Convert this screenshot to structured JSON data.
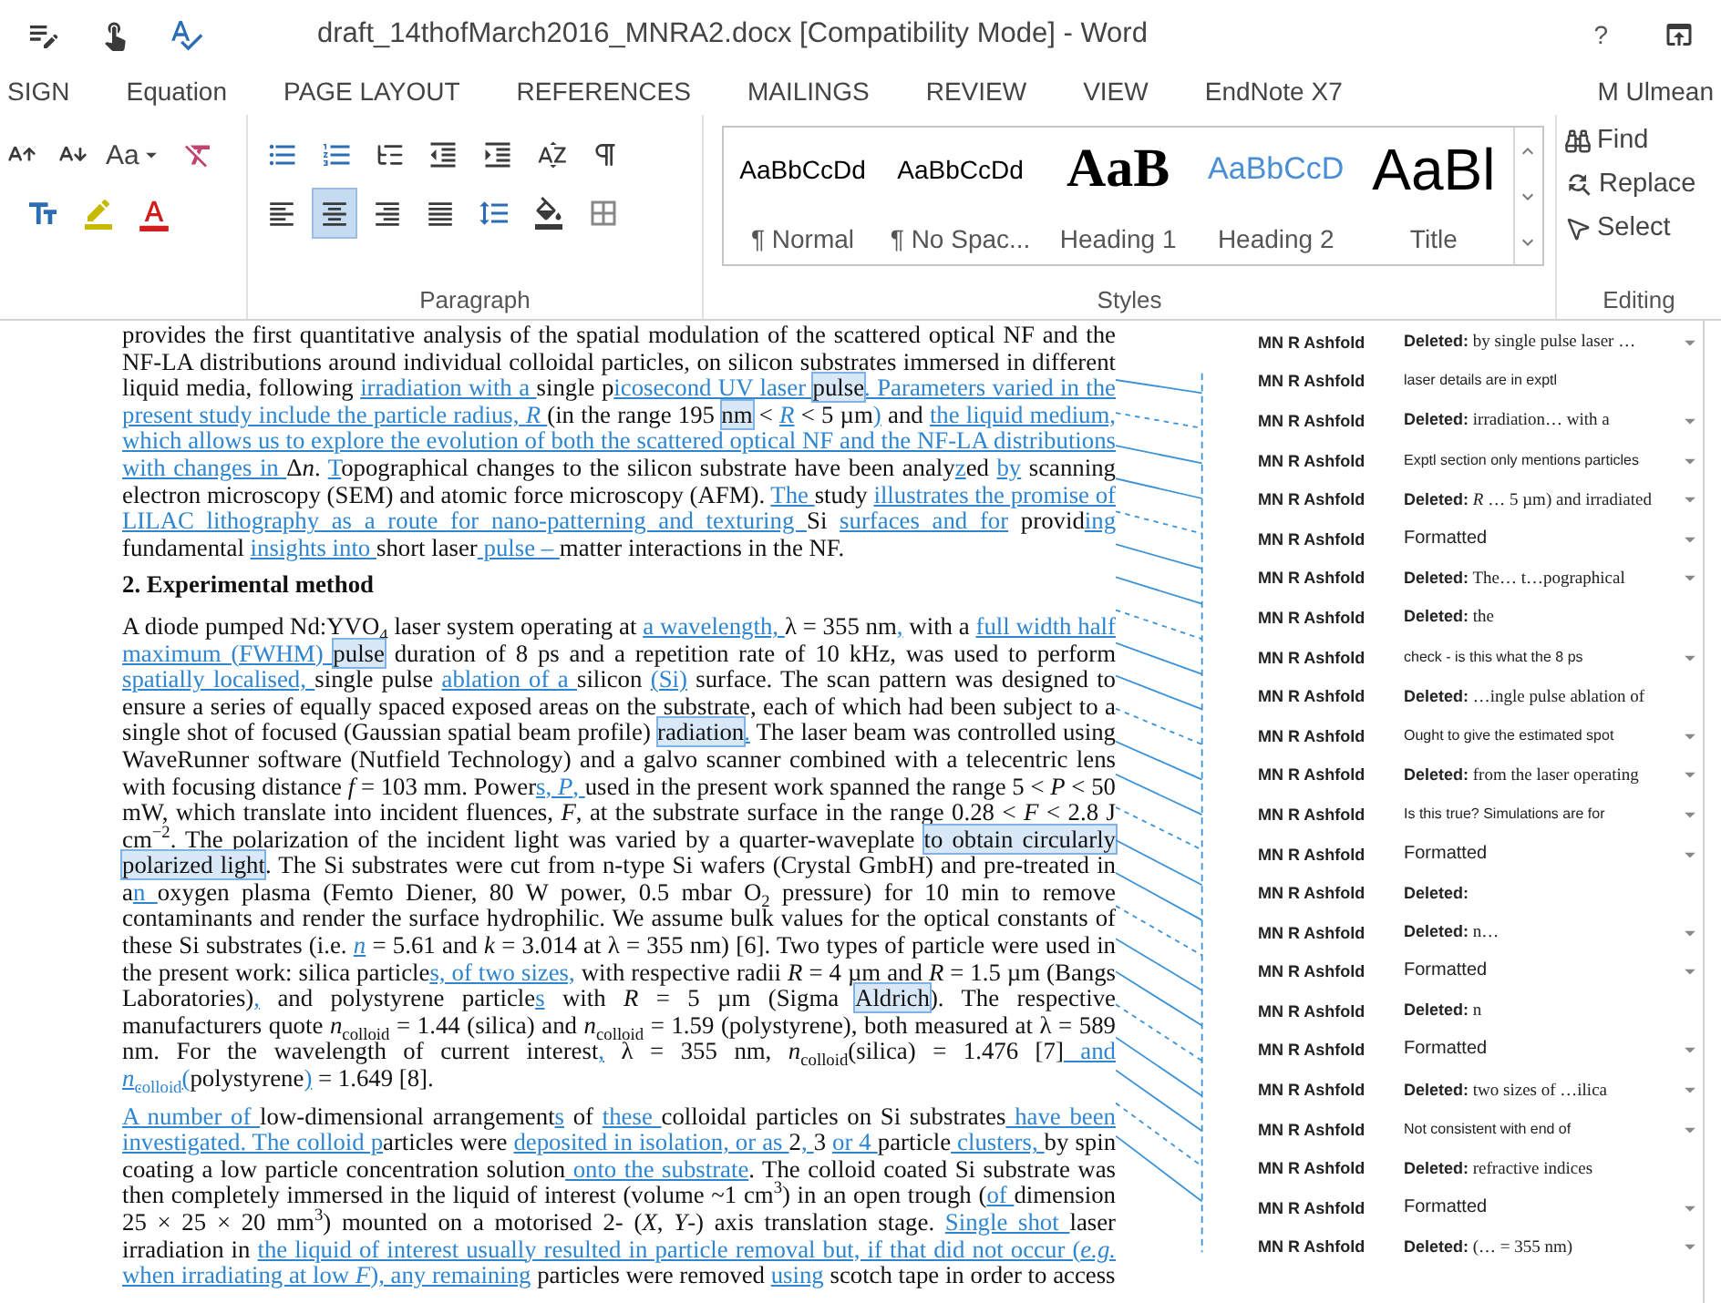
{
  "title_bar": {
    "title": "draft_14thofMarch2016_MNRA2.docx [Compatibility Mode] - Word",
    "help": "?"
  },
  "tabs": [
    {
      "label": "SIGN",
      "selected": false
    },
    {
      "label": "Equation",
      "selected": false
    },
    {
      "label": "PAGE LAYOUT",
      "selected": false
    },
    {
      "label": "REFERENCES",
      "selected": false
    },
    {
      "label": "MAILINGS",
      "selected": false
    },
    {
      "label": "REVIEW",
      "selected": false
    },
    {
      "label": "VIEW",
      "selected": false
    },
    {
      "label": "EndNote X7",
      "selected": false
    }
  ],
  "user": "M Ulmean",
  "font_group": {
    "change_case": "Aa"
  },
  "paragraph_group": {
    "label": "Paragraph",
    "alignments": [
      {
        "kind": "left",
        "selected": false
      },
      {
        "kind": "center",
        "selected": true
      },
      {
        "kind": "right",
        "selected": false
      },
      {
        "kind": "justify",
        "selected": false
      }
    ]
  },
  "styles_group": {
    "label": "Styles",
    "styles": [
      {
        "kind": "normal",
        "preview": "AaBbCcDd",
        "label": "¶ Normal"
      },
      {
        "kind": "nospace",
        "preview": "AaBbCcDd",
        "label": "¶ No Spac..."
      },
      {
        "kind": "heading1",
        "preview": "AaB",
        "label": "Heading 1"
      },
      {
        "kind": "heading2",
        "preview": "AaBbCcD",
        "label": "Heading 2"
      },
      {
        "kind": "title",
        "preview": "AaBl",
        "label": "Title"
      }
    ]
  },
  "editing_group": {
    "label": "Editing",
    "commands": [
      {
        "kind": "find",
        "label": "Find"
      },
      {
        "kind": "replace",
        "label": "Replace"
      },
      {
        "kind": "select",
        "label": "Select"
      }
    ]
  },
  "document": {
    "blocks": [
      {
        "kind": "paragraph",
        "segments": [
          {
            "text": "provides the first quantitative analysis of the spatial modulation of the scattered optical NF and the NF-LA distributions around individual colloidal particles, on silicon substrates immersed in different liquid media, following ",
            "kind": "plain"
          },
          {
            "text": "irradiation with a ",
            "kind": "inserted"
          },
          {
            "text": "single p",
            "kind": "plain"
          },
          {
            "text": "icosecond UV laser ",
            "kind": "inserted"
          },
          {
            "text": "pulse",
            "kind": "commented"
          },
          {
            "text": ". Parameters varied in the present study include the particle radius, *R* ",
            "kind": "inserted"
          },
          {
            "text": "(in the range 195 ",
            "kind": "plain"
          },
          {
            "text": "nm",
            "kind": "commented"
          },
          {
            "text": " < ",
            "kind": "plain"
          },
          {
            "text": "*R*",
            "kind": "inserted"
          },
          {
            "text": " < 5 µm",
            "kind": "plain"
          },
          {
            "text": ")",
            "kind": "inserted"
          },
          {
            "text": " and ",
            "kind": "plain"
          },
          {
            "text": "the liquid medium, which allows us to explore the evolution of both the scattered optical NF and the NF-LA distributions with changes in ",
            "kind": "inserted"
          },
          {
            "text": "Δ",
            "kind": "plain"
          },
          {
            "text": "*n*. ",
            "kind": "plain"
          },
          {
            "text": "T",
            "kind": "inserted"
          },
          {
            "text": "opographical changes to the silicon substrate have been analy",
            "kind": "plain"
          },
          {
            "text": "z",
            "kind": "inserted"
          },
          {
            "text": "ed ",
            "kind": "plain"
          },
          {
            "text": "by",
            "kind": "inserted"
          },
          {
            "text": " scanning electron microscopy (SEM) and atomic force microscopy (AFM). ",
            "kind": "plain"
          },
          {
            "text": "The ",
            "kind": "inserted"
          },
          {
            "text": "study ",
            "kind": "plain"
          },
          {
            "text": "illustrates the promise of LILAC lithography as a route for nano-patterning and texturing ",
            "kind": "inserted"
          },
          {
            "text": "Si ",
            "kind": "plain"
          },
          {
            "text": "surfaces and for",
            "kind": "inserted"
          },
          {
            "text": " provid",
            "kind": "plain"
          },
          {
            "text": "ing",
            "kind": "inserted"
          },
          {
            "text": " fundamental ",
            "kind": "plain"
          },
          {
            "text": "insights into ",
            "kind": "inserted"
          },
          {
            "text": "short laser",
            "kind": "plain"
          },
          {
            "text": " pulse – ",
            "kind": "inserted"
          },
          {
            "text": "matter interactions in the NF.",
            "kind": "plain"
          }
        ]
      },
      {
        "kind": "heading",
        "text": "2. Experimental method"
      },
      {
        "kind": "paragraph",
        "segments": [
          {
            "text": "A diode pumped Nd:YVO$_{4}$ laser system operating at ",
            "kind": "plain"
          },
          {
            "text": "a wavelength, ",
            "kind": "inserted"
          },
          {
            "text": "λ = 355 nm",
            "kind": "plain"
          },
          {
            "text": ",",
            "kind": "inserted"
          },
          {
            "text": " with a ",
            "kind": "plain"
          },
          {
            "text": "full width half maximum (FWHM) ",
            "kind": "inserted"
          },
          {
            "text": "pulse",
            "kind": "commented"
          },
          {
            "text": " duration of 8 ps and a repetition rate of 10 kHz, was used to perform ",
            "kind": "plain"
          },
          {
            "text": "spatially localised, ",
            "kind": "inserted"
          },
          {
            "text": "single pulse ",
            "kind": "plain"
          },
          {
            "text": "ablation of a ",
            "kind": "inserted"
          },
          {
            "text": "silicon ",
            "kind": "plain"
          },
          {
            "text": "(Si)",
            "kind": "inserted"
          },
          {
            "text": " surface. The scan pattern was designed to ensure a series of equally spaced exposed areas on the substrate, each of which had been subject to a single shot of focused (Gaussian spatial beam profile) ",
            "kind": "plain"
          },
          {
            "text": "radiation",
            "kind": "commented"
          },
          {
            "text": ".",
            "kind": "inserted"
          },
          {
            "text": " The laser beam was controlled using WaveRunner software (Nutfield Technology) and a galvo scanner combined with a telecentric lens with focusing distance *f* = 103 mm. Power",
            "kind": "plain"
          },
          {
            "text": "s, *P*, ",
            "kind": "inserted"
          },
          {
            "text": "used in the present work spanned the range 5 < *P* < 50 mW, which translate into incident fluences, *F*, at the substrate surface in the range 0.28 < *F* < 2.8 J cm$^{−2}$. The polarization of the incident light was varied by a quarter-waveplate ",
            "kind": "plain"
          },
          {
            "text": "to obtain circularly polarized light",
            "kind": "commented"
          },
          {
            "text": ". The Si substrates were cut from n-type Si wafers (Crystal GmbH) and pre-treated in a",
            "kind": "plain"
          },
          {
            "text": "n ",
            "kind": "inserted"
          },
          {
            "text": "oxygen plasma (Femto Diener, 80 W power, 0.5 mbar O$_{2}$ pressure) for 10 min to remove contaminants and render the surface hydrophilic. We assume bulk values for the optical constants of these Si substrates (i.e. ",
            "kind": "plain"
          },
          {
            "text": "*n*",
            "kind": "inserted"
          },
          {
            "text": " = 5.61 and *k* = 3.014 at λ = 355 nm) [6]. Two types of particle were used in the present work: silica particle",
            "kind": "plain"
          },
          {
            "text": "s, of two sizes,",
            "kind": "inserted"
          },
          {
            "text": " with respective radii *R* = 4 µm and *R* = 1.5 µm (Bangs Laboratories)",
            "kind": "plain"
          },
          {
            "text": ",",
            "kind": "inserted"
          },
          {
            "text": " and polystyrene particle",
            "kind": "plain"
          },
          {
            "text": "s",
            "kind": "inserted"
          },
          {
            "text": " with *R* = 5 µm (Sigma ",
            "kind": "plain"
          },
          {
            "text": "Aldrich",
            "kind": "commented"
          },
          {
            "text": "). The respective manufacturers quote *n*$_{colloid}$ = 1.44 (silica) and *n*$_{colloid}$ = 1.59 (polystyrene), both measured at λ = 589 nm. For the wavelength of current interest",
            "kind": "plain"
          },
          {
            "text": ",",
            "kind": "inserted"
          },
          {
            "text": " λ = 355 nm, *n*$_{colloid}$(silica) = 1.476 [7]",
            "kind": "plain"
          },
          {
            "text": " and *n*$_{colloid}$(",
            "kind": "inserted"
          },
          {
            "text": "polystyrene",
            "kind": "plain"
          },
          {
            "text": ")",
            "kind": "inserted"
          },
          {
            "text": " = 1.649 [8].",
            "kind": "plain"
          }
        ]
      },
      {
        "kind": "paragraph",
        "segments": [
          {
            "text": "A number of ",
            "kind": "inserted"
          },
          {
            "text": "low-dimensional arrangement",
            "kind": "plain"
          },
          {
            "text": "s",
            "kind": "inserted"
          },
          {
            "text": " of ",
            "kind": "plain"
          },
          {
            "text": "these ",
            "kind": "inserted"
          },
          {
            "text": "colloidal particles on Si substrates",
            "kind": "plain"
          },
          {
            "text": " have been investigated. The colloid p",
            "kind": "inserted"
          },
          {
            "text": "articles were ",
            "kind": "plain"
          },
          {
            "text": "deposited in isolation, or as ",
            "kind": "inserted"
          },
          {
            "text": "2",
            "kind": "plain"
          },
          {
            "text": ", ",
            "kind": "inserted"
          },
          {
            "text": "3 ",
            "kind": "plain"
          },
          {
            "text": "or 4 ",
            "kind": "inserted"
          },
          {
            "text": "particle",
            "kind": "plain"
          },
          {
            "text": " clusters, ",
            "kind": "inserted"
          },
          {
            "text": "by spin coating a low particle concentration solution",
            "kind": "plain"
          },
          {
            "text": " onto the substrate",
            "kind": "inserted"
          },
          {
            "text": ". The colloid coated Si substrate was then completely immersed in the liquid of interest (volume ~1 cm$^{3}$) in an open trough (",
            "kind": "plain"
          },
          {
            "text": "of ",
            "kind": "inserted"
          },
          {
            "text": "dimension 25 × 25 × 20 mm$^{3}$) mounted on a motorised 2- (*X*, *Y*-) axis translation stage. ",
            "kind": "plain"
          },
          {
            "text": "Single shot ",
            "kind": "inserted"
          },
          {
            "text": "laser irradiation in ",
            "kind": "plain"
          },
          {
            "text": "the liquid of interest usually resulted in particle removal but, if that did not occur (*e.g.* when irradiating at low *F*), any remaining",
            "kind": "inserted"
          },
          {
            "text": " particles were removed ",
            "kind": "plain"
          },
          {
            "text": "using",
            "kind": "inserted"
          },
          {
            "text": " scotch tape in order to access",
            "kind": "plain"
          }
        ]
      }
    ]
  },
  "changes": [
    {
      "author": "MN R Ashfold",
      "kind": "deleted",
      "label": "Deleted:",
      "text": "by single pulse laser …",
      "menu": true
    },
    {
      "author": "MN R Ashfold",
      "kind": "comment",
      "text": "laser details are in exptl",
      "menu": false
    },
    {
      "author": "MN R Ashfold",
      "kind": "deleted",
      "label": "Deleted:",
      "text": "irradiation… with a",
      "menu": true
    },
    {
      "author": "MN R Ashfold",
      "kind": "comment",
      "text": "Exptl section only mentions particles",
      "menu": true
    },
    {
      "author": "MN R Ashfold",
      "kind": "deleted",
      "label": "Deleted:",
      "text": "*R* … 5 µm) and irradiated",
      "menu": true
    },
    {
      "author": "MN R Ashfold",
      "kind": "formatted",
      "label": "Formatted",
      "menu": true
    },
    {
      "author": "MN R Ashfold",
      "kind": "deleted",
      "label": "Deleted:",
      "text": "The… t…pographical",
      "menu": true
    },
    {
      "author": "MN R Ashfold",
      "kind": "deleted",
      "label": "Deleted:",
      "text": "the",
      "menu": false
    },
    {
      "author": "MN R Ashfold",
      "kind": "comment",
      "text": "check - is this what the 8 ps",
      "menu": true
    },
    {
      "author": "MN R Ashfold",
      "kind": "deleted",
      "label": "Deleted:",
      "text": "…ingle pulse ablation of",
      "menu": false
    },
    {
      "author": "MN R Ashfold",
      "kind": "comment",
      "text": "Ought to give the estimated spot",
      "menu": true
    },
    {
      "author": "MN R Ashfold",
      "kind": "deleted",
      "label": "Deleted:",
      "text": "from the laser operating",
      "menu": true
    },
    {
      "author": "MN R Ashfold",
      "kind": "comment",
      "text": "Is this true?  Simulations are for",
      "menu": true
    },
    {
      "author": "MN R Ashfold",
      "kind": "formatted",
      "label": "Formatted",
      "menu": true
    },
    {
      "author": "MN R Ashfold",
      "kind": "deleted",
      "label": "Deleted:",
      "menu": false
    },
    {
      "author": "MN R Ashfold",
      "kind": "deleted",
      "label": "Deleted:",
      "text": "n…",
      "menu": true
    },
    {
      "author": "MN R Ashfold",
      "kind": "formatted",
      "label": "Formatted",
      "menu": true
    },
    {
      "author": "MN R Ashfold",
      "kind": "deleted",
      "label": "Deleted:",
      "text": "n",
      "menu": false
    },
    {
      "author": "MN R Ashfold",
      "kind": "formatted",
      "label": "Formatted",
      "menu": true
    },
    {
      "author": "MN R Ashfold",
      "kind": "deleted",
      "label": "Deleted:",
      "text": "two sizes of …ilica",
      "menu": true
    },
    {
      "author": "MN R Ashfold",
      "kind": "comment",
      "text": "Not consistent with end of",
      "menu": true
    },
    {
      "author": "MN R Ashfold",
      "kind": "deleted",
      "label": "Deleted:",
      "text": "refractive indices",
      "menu": false
    },
    {
      "author": "MN R Ashfold",
      "kind": "formatted",
      "label": "Formatted",
      "menu": true
    },
    {
      "author": "MN R Ashfold",
      "kind": "deleted",
      "label": "Deleted:",
      "text": "(… = 355 nm)",
      "menu": true
    }
  ]
}
